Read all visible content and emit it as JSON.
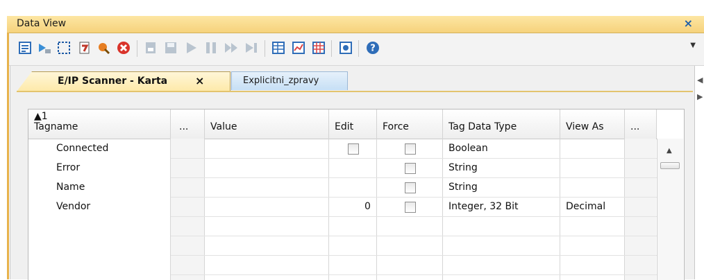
{
  "window": {
    "title": "Data View",
    "close_glyph": "×"
  },
  "toolbar": {
    "buttons": [
      {
        "name": "properties-icon",
        "color": "#2f6db8"
      },
      {
        "name": "go-to-icon",
        "color": "#3a8ed6"
      },
      {
        "name": "select-icon",
        "color": "#1e5aa5"
      },
      {
        "name": "document-icon",
        "color": "#c0392b"
      },
      {
        "name": "filter-icon",
        "color": "#e67e22"
      },
      {
        "name": "stop-icon",
        "color": "#d9342b"
      },
      {
        "name": "new-icon",
        "color": "#b9c4cf"
      },
      {
        "name": "save-icon",
        "color": "#b9c4cf"
      },
      {
        "name": "play-icon",
        "color": "#b9c4cf"
      },
      {
        "name": "pause-icon",
        "color": "#b9c4cf"
      },
      {
        "name": "fast-forward-icon",
        "color": "#b9c4cf"
      },
      {
        "name": "step-end-icon",
        "color": "#b9c4cf"
      },
      {
        "name": "table-view-icon",
        "color": "#2f6db8"
      },
      {
        "name": "trend-view-icon",
        "color": "#2f6db8"
      },
      {
        "name": "grid-view-icon",
        "color": "#2f6db8"
      },
      {
        "name": "settings-view-icon",
        "color": "#2f6db8"
      },
      {
        "name": "help-icon",
        "color": "#2f6db8"
      }
    ],
    "dropdown_glyph": "▼"
  },
  "tabs": [
    {
      "label": "E/IP Scanner - Karta",
      "close": "×",
      "active": true
    },
    {
      "label": "Explicitni_zpravy",
      "active": false
    }
  ],
  "table": {
    "sort_indicator": "▲1",
    "headers": [
      "Tagname",
      "...",
      "Value",
      "Edit",
      "Force",
      "Tag Data Type",
      "View As",
      "..."
    ],
    "rows": [
      {
        "tagname": "Connected",
        "value": "",
        "edit_checkbox": true,
        "force_checkbox": true,
        "type": "Boolean",
        "view_as": ""
      },
      {
        "tagname": "Error",
        "value": "",
        "edit_checkbox": false,
        "force_checkbox": true,
        "type": "String",
        "view_as": ""
      },
      {
        "tagname": "Name",
        "value": "",
        "edit_checkbox": false,
        "force_checkbox": true,
        "type": "String",
        "view_as": ""
      },
      {
        "tagname": "Vendor",
        "value": "0",
        "edit_checkbox": false,
        "force_checkbox": true,
        "type": "Integer, 32 Bit",
        "view_as": "Decimal"
      }
    ]
  },
  "scrollbar": {
    "up_glyph": "▲"
  },
  "side_arrows": [
    "◀",
    "▶"
  ]
}
